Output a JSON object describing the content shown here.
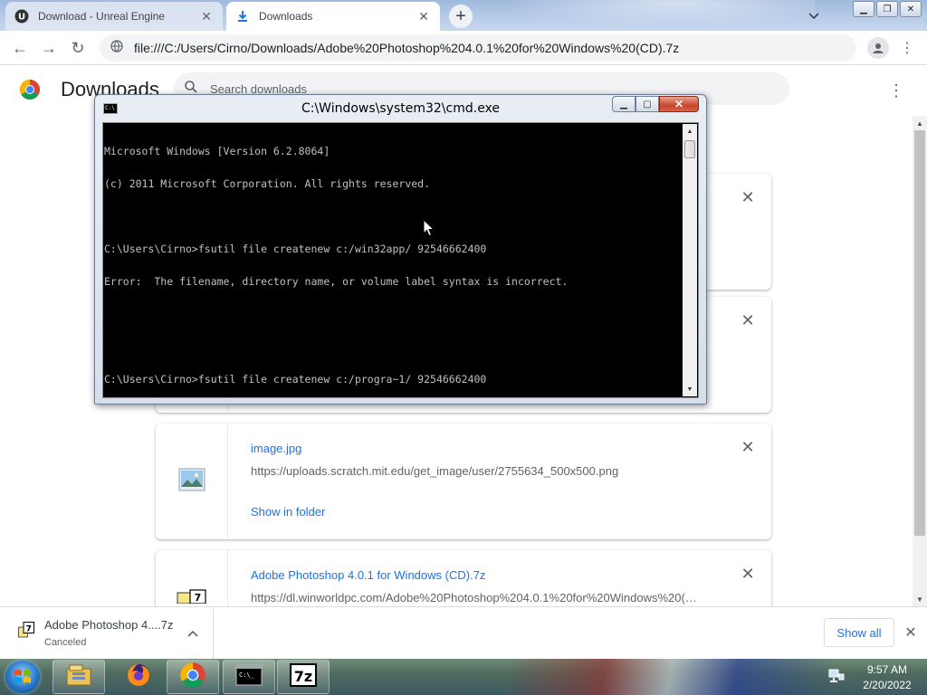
{
  "browser": {
    "tabs": [
      {
        "title": "Download - Unreal Engine",
        "icon": "unreal-engine-icon",
        "active": false
      },
      {
        "title": "Downloads",
        "icon": "download-icon",
        "active": true
      }
    ],
    "url": "file:///C:/Users/Cirno/Downloads/Adobe%20Photoshop%204.0.1%20for%20Windows%20(CD).7z"
  },
  "downloads_page": {
    "title": "Downloads",
    "search_placeholder": "Search downloads",
    "items": [
      {
        "name": "",
        "source": "",
        "action": ""
      },
      {
        "name": "",
        "source": "",
        "action": ""
      },
      {
        "name": "image.jpg",
        "source": "https://uploads.scratch.mit.edu/get_image/user/2755634_500x500.png",
        "action": "Show in folder",
        "icon": "image-file-icon"
      },
      {
        "name": "Adobe Photoshop 4.0.1 for Windows (CD).7z",
        "source": "https://dl.winworldpc.com/Adobe%20Photoshop%204.0.1%20for%20Windows%20(C...",
        "action": "",
        "icon": "7zip-file-icon"
      }
    ]
  },
  "shelf": {
    "file_name": "Adobe Photoshop 4....7z",
    "status": "Canceled",
    "show_all_label": "Show all"
  },
  "cmd": {
    "title": "C:\\Windows\\system32\\cmd.exe",
    "lines": [
      "Microsoft Windows [Version 6.2.8064]",
      "(c) 2011 Microsoft Corporation. All rights reserved.",
      "",
      "C:\\Users\\Cirno>fsutil file createnew c:/win32app/ 92546662400",
      "Error:  The filename, directory name, or volume label syntax is incorrect.",
      "",
      "",
      "C:\\Users\\Cirno>fsutil file createnew c:/progra~1/ 92546662400"
    ]
  },
  "taskbar": {
    "pinned": [
      "explorer-icon",
      "firefox-icon",
      "chrome-icon",
      "cmd-icon",
      "7zip-icon"
    ],
    "time": "9:57 AM",
    "date": "2/20/2022"
  },
  "colors": {
    "link_blue": "#1a73e8",
    "console_bg": "#000000",
    "console_text": "#c0c0c0"
  }
}
